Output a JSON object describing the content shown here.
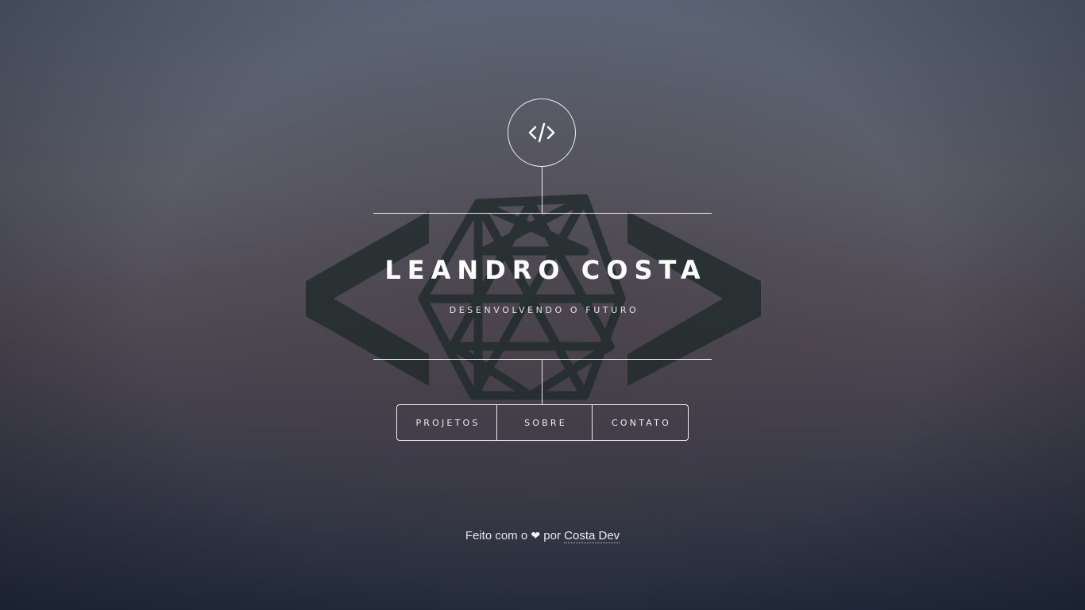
{
  "header": {
    "logo_icon": "code-icon",
    "title": "LEANDRO COSTA",
    "subtitle": "DESENVOLVENDO O FUTURO"
  },
  "background": {
    "graphic_icon": "code-brackets-polyhedron-icon"
  },
  "nav": {
    "items": [
      {
        "label": "PROJETOS"
      },
      {
        "label": "SOBRE"
      },
      {
        "label": "CONTATO"
      }
    ]
  },
  "footer": {
    "text_before": "Feito com o",
    "heart": "❤",
    "text_middle": "por",
    "link_label": "Costa Dev"
  },
  "colors": {
    "text": "#ffffff",
    "bg_top": "#5a6474",
    "bg_bottom": "#222b3a"
  }
}
